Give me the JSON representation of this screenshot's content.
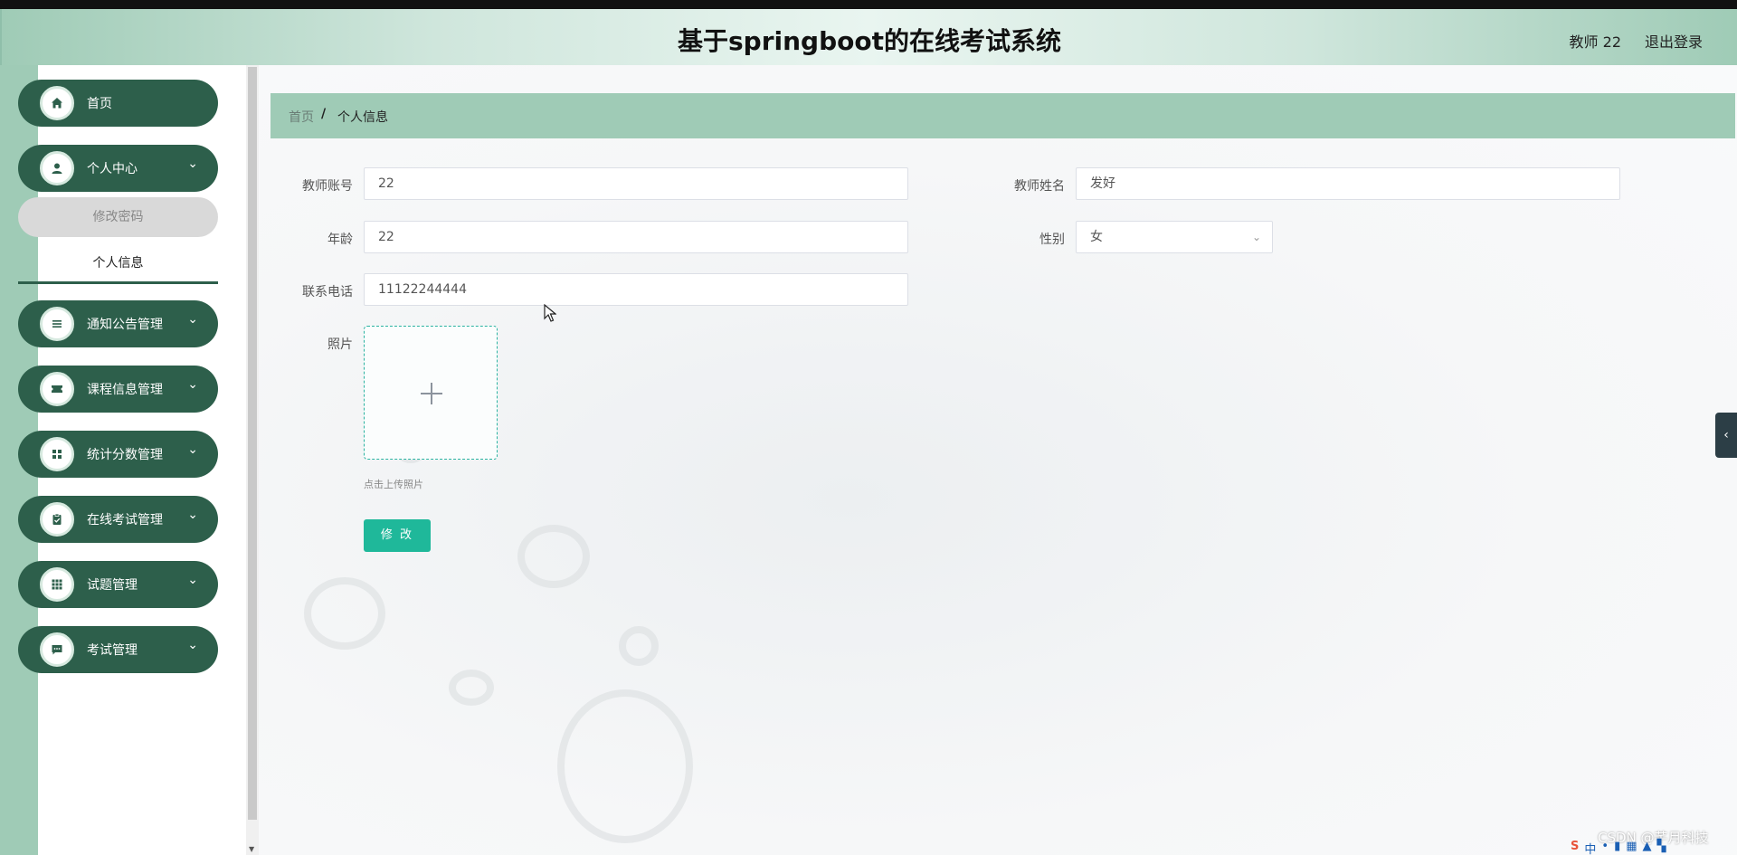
{
  "header": {
    "title": "基于springboot的在线考试系统",
    "user": "教师 22",
    "logout": "退出登录"
  },
  "sidebar": {
    "items": [
      {
        "label": "首页",
        "icon": "home-icon"
      },
      {
        "label": "个人中心",
        "icon": "user-icon",
        "expanded": true,
        "children": [
          "修改密码",
          "个人信息"
        ],
        "active_child": "个人信息"
      },
      {
        "label": "通知公告管理",
        "icon": "list-icon"
      },
      {
        "label": "课程信息管理",
        "icon": "ticket-icon"
      },
      {
        "label": "统计分数管理",
        "icon": "grid-icon"
      },
      {
        "label": "在线考试管理",
        "icon": "clipboard-icon"
      },
      {
        "label": "试题管理",
        "icon": "apps-icon"
      },
      {
        "label": "考试管理",
        "icon": "message-icon"
      }
    ]
  },
  "breadcrumb": {
    "home": "首页",
    "separator": "/",
    "current": "个人信息"
  },
  "form": {
    "account_label": "教师账号",
    "account_value": "22",
    "name_label": "教师姓名",
    "name_value": "发好",
    "age_label": "年龄",
    "age_value": "22",
    "gender_label": "性别",
    "gender_value": "女",
    "phone_label": "联系电话",
    "phone_value": "11122244444",
    "photo_label": "照片",
    "upload_hint": "点击上传照片",
    "submit_label": "修 改"
  },
  "watermark": "CSDN @芊月科技",
  "colors": {
    "accent": "#9fcbb6",
    "menu": "#2d5f4b",
    "button": "#1fb89a"
  }
}
